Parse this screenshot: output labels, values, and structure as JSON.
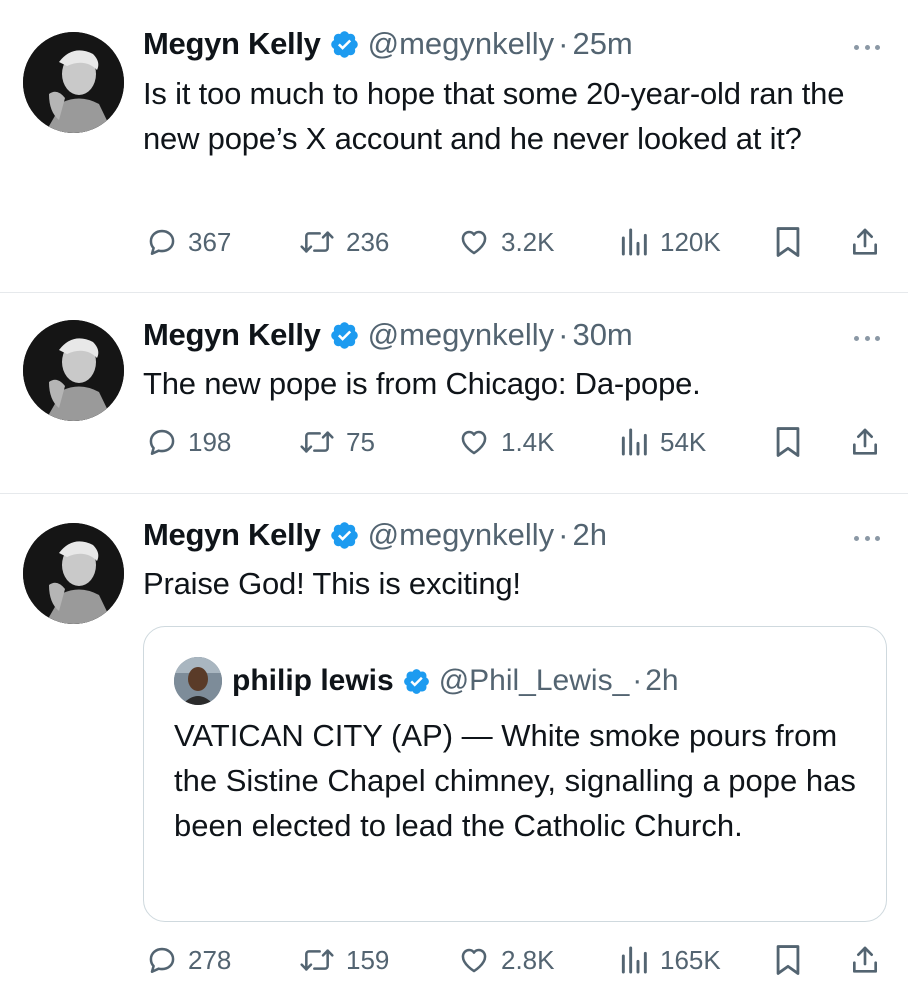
{
  "tweets": [
    {
      "name": "Megyn Kelly",
      "handle": "@megynkelly",
      "dot": "·",
      "time": "25m",
      "text": "Is it too much to hope that some 20-year-old ran the new pope’s X account and he never looked at it?",
      "replies": "367",
      "reposts": "236",
      "likes": "3.2K",
      "views": "120K"
    },
    {
      "name": "Megyn Kelly",
      "handle": "@megynkelly",
      "dot": "·",
      "time": "30m",
      "text": "The new pope is from Chicago: Da-pope.",
      "replies": "198",
      "reposts": "75",
      "likes": "1.4K",
      "views": "54K"
    },
    {
      "name": "Megyn Kelly",
      "handle": "@megynkelly",
      "dot": "·",
      "time": "2h",
      "text": "Praise God! This is exciting!",
      "replies": "278",
      "reposts": "159",
      "likes": "2.8K",
      "views": "165K",
      "quote": {
        "name": "philip lewis",
        "handle": "@Phil_Lewis_",
        "dot": "·",
        "time": "2h",
        "text": "VATICAN CITY (AP) — White smoke pours from the Sistine Chapel chimney, signalling a pope has been elected to lead the Catholic Church."
      }
    }
  ],
  "colors": {
    "verified": "#1d9bf0",
    "muted": "#536471",
    "text": "#0f1419",
    "divider": "#e6e9ec"
  },
  "icons": [
    "verified-badge-icon",
    "more-icon",
    "reply-icon",
    "repost-icon",
    "like-icon",
    "views-icon",
    "bookmark-icon",
    "share-icon"
  ]
}
